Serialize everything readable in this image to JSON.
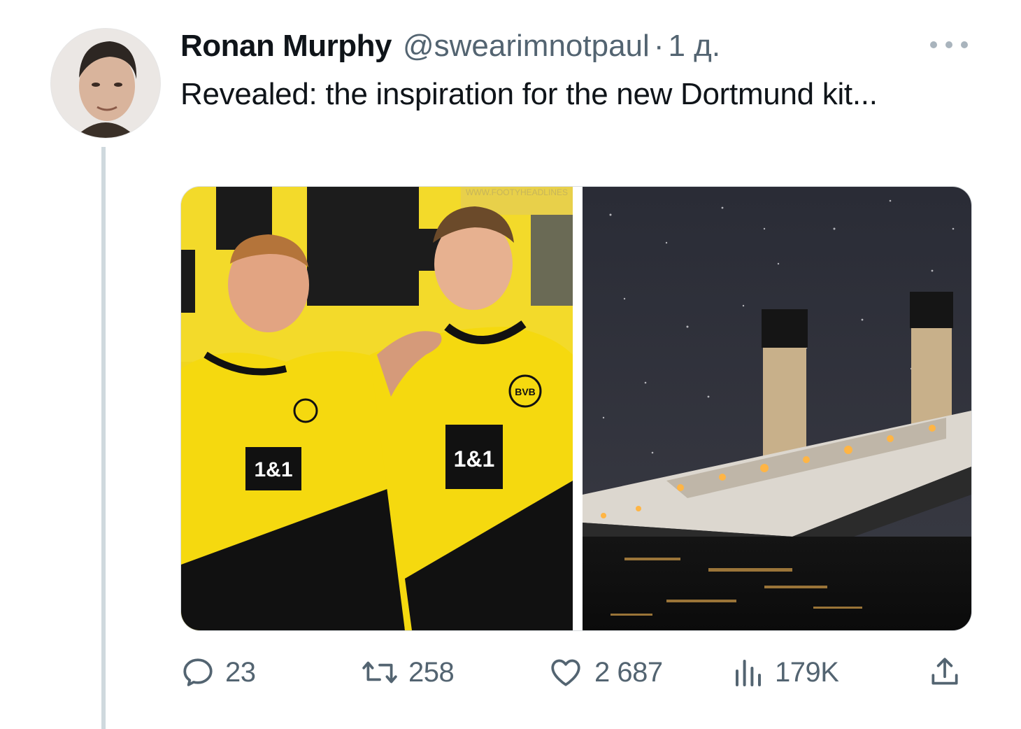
{
  "tweet": {
    "author_name": "Ronan Murphy",
    "handle": "@swearimnotpaul",
    "separator": "·",
    "time": "1 д.",
    "text": "Revealed: the inspiration for the new Dortmund kit...",
    "media": {
      "left": {
        "sponsor": "1&1",
        "crest": "BVB",
        "watermark": "WWW.FOOTYHEADLINES"
      },
      "right": {}
    },
    "stats": {
      "replies": "23",
      "reposts": "258",
      "likes": "2 687",
      "views": "179K"
    }
  },
  "icons": {
    "more": "more-horizontal-icon",
    "reply": "reply-icon",
    "repost": "repost-icon",
    "like": "heart-icon",
    "views": "views-chart-icon",
    "share": "share-icon"
  },
  "colors": {
    "text": "#0f1419",
    "muted": "#536471",
    "thread_line": "#cfd9de",
    "bvb_yellow": "#f6dd1b"
  }
}
